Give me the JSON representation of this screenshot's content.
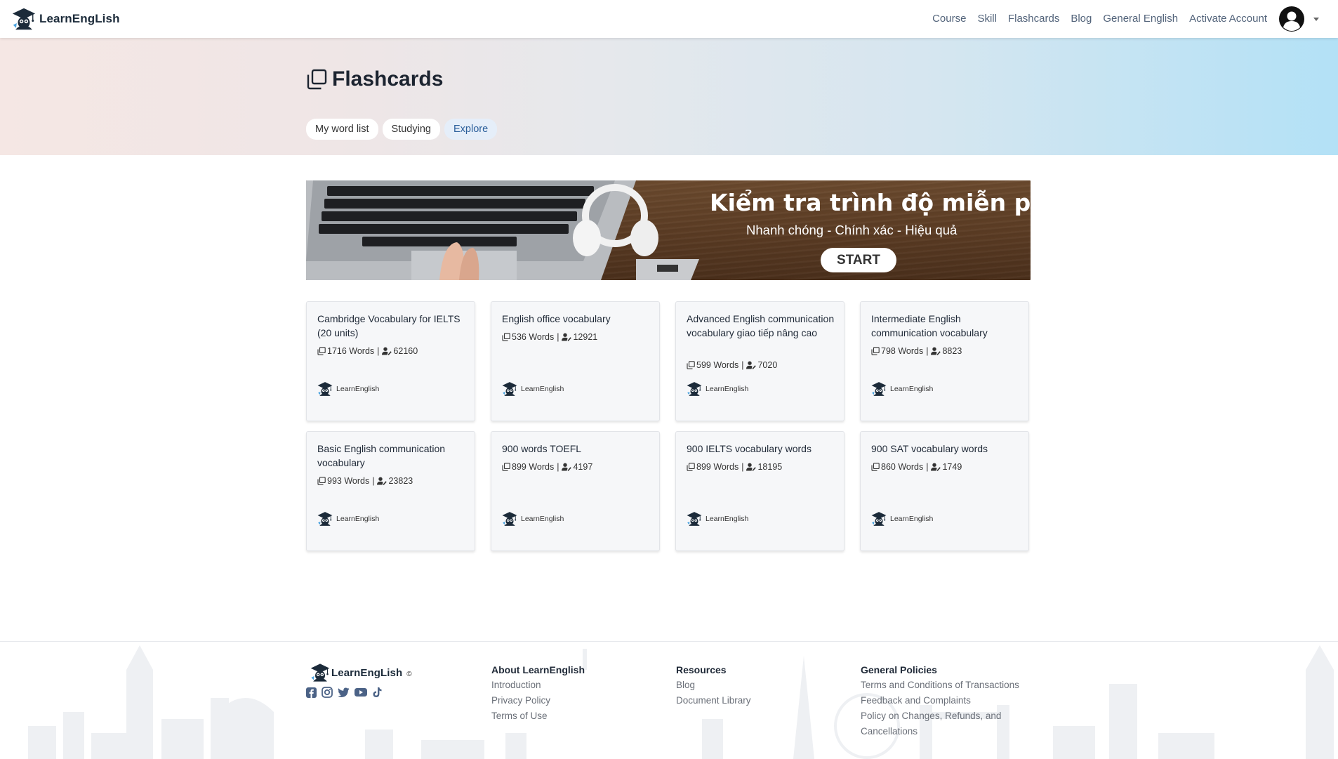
{
  "navbar": {
    "brand": "LearnEngLish",
    "links": [
      "Course",
      "Skill",
      "Flashcards",
      "Blog",
      "General English",
      "Activate Account"
    ]
  },
  "hero": {
    "title": "Flashcards",
    "tabs": [
      "My word list",
      "Studying",
      "Explore"
    ],
    "active_tab": "Explore"
  },
  "banner": {
    "title": "Kiểm tra trình độ miễn phí",
    "subtitle": "Nhanh chóng - Chính xác - Hiệu quả",
    "button": "START"
  },
  "cards": [
    {
      "title": "Cambridge Vocabulary for IELTS (20 units)",
      "words": "1716 Words",
      "learners": "62160",
      "author": "LearnEnglish"
    },
    {
      "title": "English office vocabulary",
      "words": "536 Words",
      "learners": "12921",
      "author": "LearnEnglish"
    },
    {
      "title": "Advanced English communication vocabulary giao tiếp nâng cao",
      "words": "599 Words",
      "learners": "7020",
      "author": "LearnEnglish"
    },
    {
      "title": "Intermediate English communication vocabulary",
      "words": "798 Words",
      "learners": "8823",
      "author": "LearnEnglish"
    },
    {
      "title": "Basic English communication vocabulary",
      "words": "993 Words",
      "learners": "23823",
      "author": "LearnEnglish"
    },
    {
      "title": "900 words TOEFL",
      "words": "899 Words",
      "learners": "4197",
      "author": "LearnEnglish"
    },
    {
      "title": "900 IELTS vocabulary words",
      "words": "899 Words",
      "learners": "18195",
      "author": "LearnEnglish"
    },
    {
      "title": "900 SAT vocabulary words",
      "words": "860 Words",
      "learners": "1749",
      "author": "LearnEnglish"
    }
  ],
  "footer": {
    "brand": "LearnEngLish",
    "copyright": "©",
    "socials": [
      "facebook-icon",
      "instagram-icon",
      "twitter-icon",
      "youtube-icon",
      "tiktok-icon"
    ],
    "about": {
      "title": "About LearnEnglish",
      "links": [
        "Introduction",
        "Privacy Policy",
        "Terms of Use"
      ]
    },
    "resources": {
      "title": "Resources",
      "links": [
        "Blog",
        "Document Library"
      ]
    },
    "policies": {
      "title": "General Policies",
      "links": [
        "Terms and Conditions of Transactions",
        "Feedback and Complaints",
        "Policy on Changes, Refunds, and Cancellations"
      ]
    }
  },
  "colors": {
    "accent": "#2a5e9a",
    "nav_text": "#52637a",
    "brand": "#1c2b3a"
  }
}
